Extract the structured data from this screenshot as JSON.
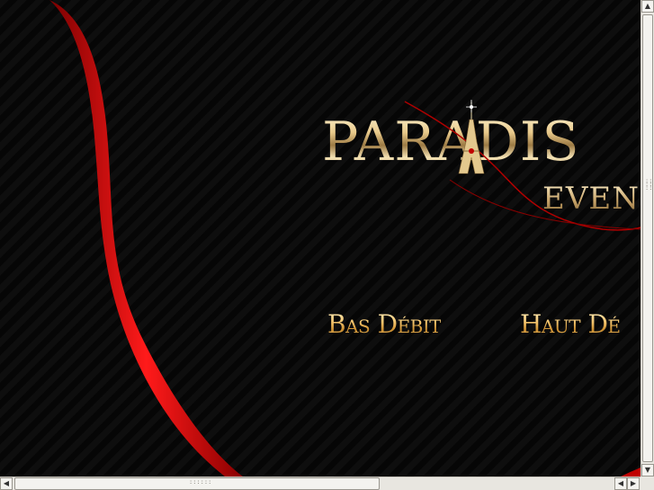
{
  "logo": {
    "title": "PARADIS",
    "subtitle": "EVEN"
  },
  "nav": {
    "low_bandwidth": "Bas Débit",
    "high_bandwidth": "Haut Dé"
  },
  "colors": {
    "background": "#0a0a0a",
    "ribbon": "#d40000",
    "gold": "#e8c98a"
  },
  "scrollbars": {
    "up_icon": "arrow-up-icon",
    "down_icon": "arrow-down-icon",
    "left_icon": "arrow-left-icon",
    "right_icon": "arrow-right-icon"
  }
}
